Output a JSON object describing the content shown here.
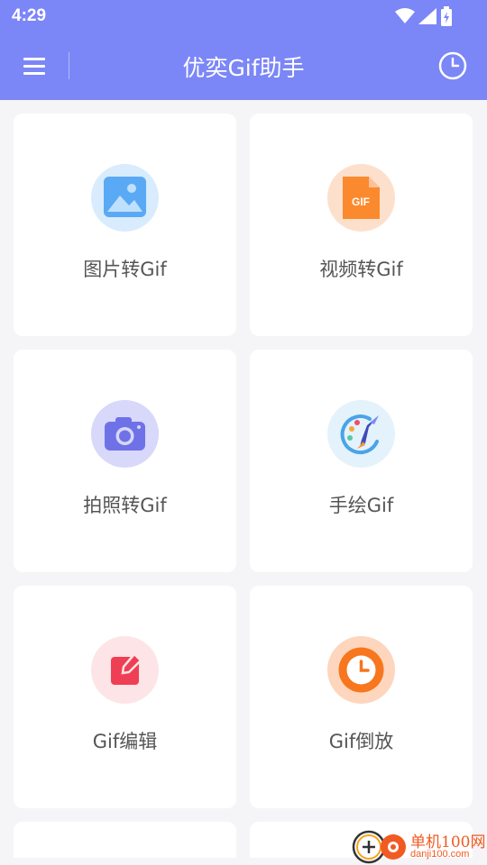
{
  "status_bar": {
    "time": "4:29",
    "icons": [
      "wifi-icon",
      "signal-icon",
      "battery-charging-icon"
    ]
  },
  "app_bar": {
    "title": "优奕Gif助手",
    "menu_icon": "menu-icon",
    "history_icon": "clock-icon"
  },
  "cards": [
    {
      "label": "图片转Gif",
      "icon": "image-icon",
      "circle_color": "#d8ecfd",
      "accent": "#5aa9f5"
    },
    {
      "label": "视频转Gif",
      "icon": "gif-file-icon",
      "circle_color": "#fde0cc",
      "accent": "#fb8a2e"
    },
    {
      "label": "拍照转Gif",
      "icon": "camera-icon",
      "circle_color": "#d7d8fa",
      "accent": "#6f72e6"
    },
    {
      "label": "手绘Gif",
      "icon": "palette-rocket-icon",
      "circle_color": "#e4f2fc",
      "accent": "#4aa3e8"
    },
    {
      "label": "Gif编辑",
      "icon": "edit-icon",
      "circle_color": "#fde4e6",
      "accent": "#ef3f55"
    },
    {
      "label": "Gif倒放",
      "icon": "reverse-clock-icon",
      "circle_color": "#fdd6bd",
      "accent": "#f7761e"
    }
  ],
  "watermark": {
    "title": "单机100网",
    "url": "danji100.com"
  },
  "colors": {
    "primary": "#7b86f7",
    "background": "#f5f5f7"
  }
}
